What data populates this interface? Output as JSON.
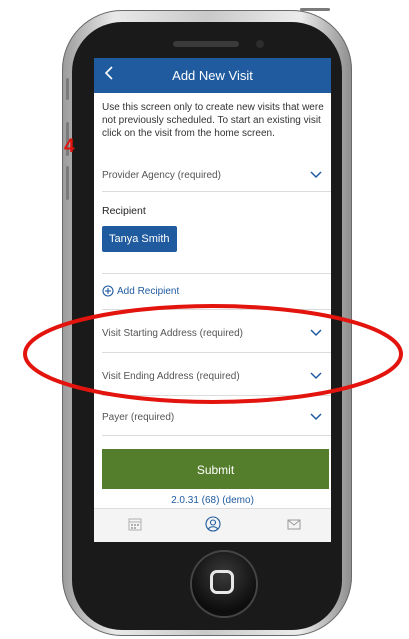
{
  "annotation": {
    "step_number": "4"
  },
  "header": {
    "title": "Add New Visit",
    "back_icon": "chevron-left-icon"
  },
  "intro_text": "Use this screen only to create new visits that were not previously scheduled. To start an existing visit click on the visit from the home screen.",
  "fields": {
    "provider_agency": "Provider Agency (required)",
    "recipient_label": "Recipient",
    "recipient_chip": "Tanya Smith",
    "add_recipient": "Add Recipient",
    "visit_starting_address": "Visit Starting Address (required)",
    "visit_ending_address": "Visit Ending Address (required)",
    "payer": "Payer (required)"
  },
  "submit_label": "Submit",
  "version": "2.0.31 (68) (demo)",
  "tabs": [
    {
      "icon": "calendar-icon"
    },
    {
      "icon": "profile-icon"
    },
    {
      "icon": "mail-icon"
    }
  ],
  "colors": {
    "header_blue": "#1f5b9e",
    "submit_green": "#547e2b",
    "annotation_red": "#e3140d"
  }
}
